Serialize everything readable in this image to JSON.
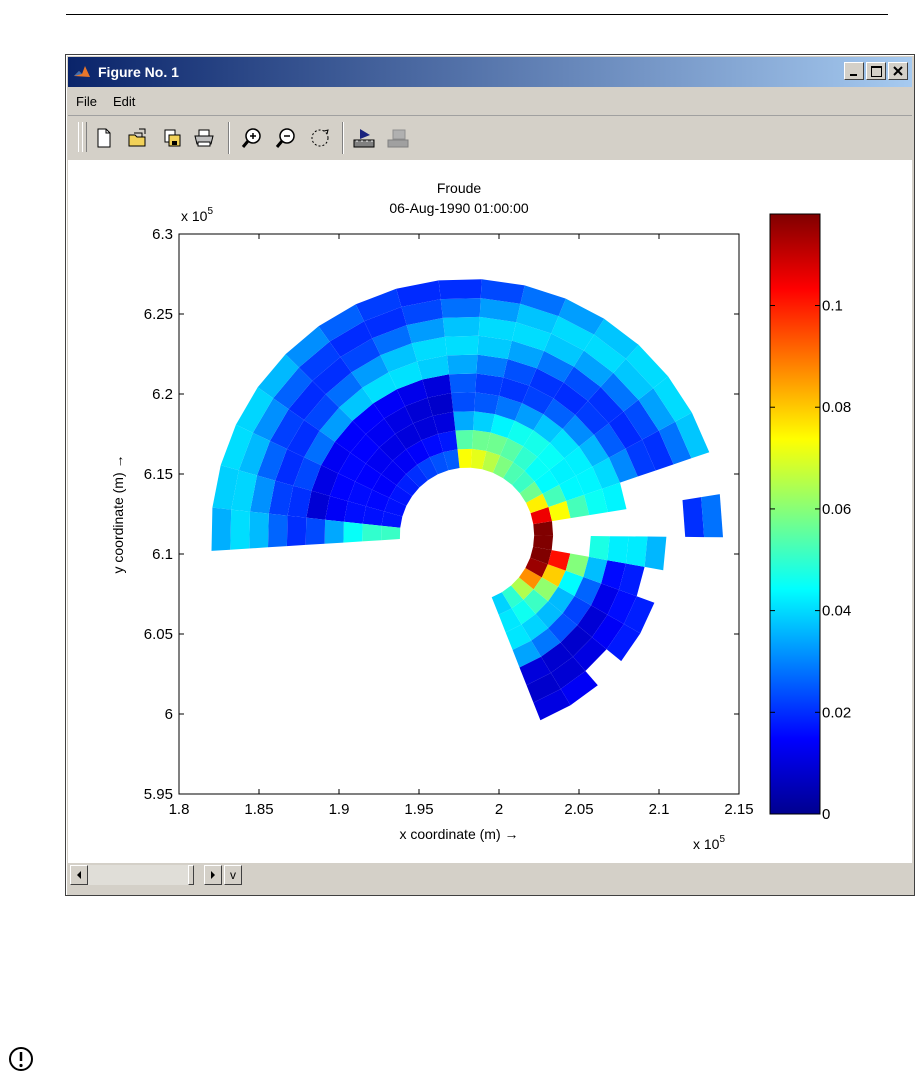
{
  "window": {
    "title": "Figure No. 1"
  },
  "menu": {
    "items": [
      "File",
      "Edit"
    ]
  },
  "toolbar": {
    "buttons": [
      "new-figure",
      "open-file",
      "save-file",
      "print",
      "zoom-in",
      "zoom-out",
      "rotate",
      "movie-play",
      "movie-pause"
    ]
  },
  "scrollbar": {
    "v_label": "v"
  },
  "colors": {
    "titlebar_start": "#0a246a",
    "titlebar_end": "#a6caf0",
    "chrome": "#d4d0c8"
  },
  "chart_data": {
    "type": "heatmap",
    "title": "Froude",
    "subtitle": "06-Aug-1990 01:00:00",
    "xlabel": "x coordinate (m) →",
    "ylabel": "y coordinate (m) →",
    "x_multiplier": "x 10",
    "x_exponent": "5",
    "y_multiplier": "x 10",
    "y_exponent": "5",
    "xlim": [
      1.8,
      2.15
    ],
    "ylim": [
      5.95,
      6.3
    ],
    "xticks": [
      "1.8",
      "1.85",
      "1.9",
      "1.95",
      "2",
      "2.05",
      "2.1",
      "2.15"
    ],
    "yticks": [
      "5.95",
      "6",
      "6.05",
      "6.1",
      "6.15",
      "6.2",
      "6.25",
      "6.3"
    ],
    "colorbar": {
      "range": [
        0,
        0.118
      ],
      "ticks": [
        "0",
        "0.02",
        "0.04",
        "0.06",
        "0.08",
        "0.1"
      ],
      "colormap": "jet"
    },
    "description_values": {
      "outer_ring_value": 0.03,
      "peak_value": 0.118,
      "peak_location": [
        2.025,
        6.108
      ]
    }
  }
}
